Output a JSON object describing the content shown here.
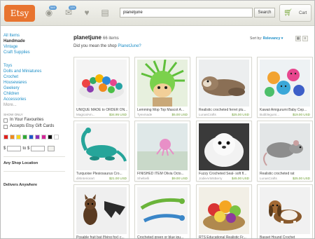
{
  "header": {
    "logo": "Etsy",
    "badge_favorites": "549",
    "badge_messages": "129",
    "search_value": "planetjune",
    "search_button": "Search",
    "cart_label": "Cart"
  },
  "sidebar": {
    "categories": [
      "All Items",
      "Handmade",
      "Vintage",
      "Craft Supplies"
    ],
    "subcategories": [
      "Toys",
      "Dolls and Miniatures",
      "Crochet",
      "Housewares",
      "Geekery",
      "Children",
      "Accessories",
      "More..."
    ],
    "show_only_label": "SHOW ONLY",
    "favorites_label": "In Your Favourites",
    "giftcard_label": "Accepts Etsy Gift Cards",
    "colors": [
      "#e0201c",
      "#f08a1e",
      "#f5d61b",
      "#2fa935",
      "#1e58c8",
      "#8c2fb8",
      "#d6269a",
      "#111111",
      "#ffffff"
    ],
    "price_currency": "$",
    "price_to": "to $",
    "shop_location": "Any Shop Location",
    "delivers": "Delivers Anywhere"
  },
  "main": {
    "shop_name": "planetjune",
    "item_count": "66 items",
    "suggest_prefix": "Did you mean the shop",
    "suggest_link": "PlanetJune?",
    "sort_label": "Sort by:",
    "sort_value": "Relevancy",
    "sort_caret": "▾",
    "items": [
      {
        "title": "UNIQUE MADE to ORDER ON...",
        "shop": "MagicalAm...",
        "price": "$34.95 USD",
        "img": "collection"
      },
      {
        "title": "Lemming Mop Top Mascot A...",
        "shop": "Tyexmade",
        "price": "$5.00 USD",
        "img": "mop"
      },
      {
        "title": "Realistic crocheted ferret plu...",
        "shop": "LunasCrafts",
        "price": "$25.00 USD",
        "img": "ferret"
      },
      {
        "title": "Kawaii Amigurumi Baby Cep...",
        "shop": "Bubblegumi...",
        "price": "$19.00 USD",
        "img": "octopus"
      },
      {
        "title": "Turquoise Plesiosaurus Cro...",
        "shop": "dirtinteriorart",
        "price": "$21.00 USD",
        "img": "plesio"
      },
      {
        "title": "FINISHED ITEM Olivia Octo...",
        "shop": "Sheltielli",
        "price": "$9.00 USD",
        "img": "smallocto"
      },
      {
        "title": "Fuzzy Crocheted Seal- soft fl...",
        "shop": "JodieArtsNBerry",
        "price": "$45.00 USD",
        "img": "seal"
      },
      {
        "title": "Realistic crocheted rat",
        "shop": "LunasCrafts",
        "price": "$25.00 USD",
        "img": "rat"
      },
      {
        "title": "Posable fruit bat (flying fox) c...",
        "shop": "LunasCrafts",
        "price": "$20.00 USD",
        "img": "bats"
      },
      {
        "title": "Crocheted green or blue igu...",
        "shop": "LunasArtsStudio",
        "price": "$20.00 USD",
        "img": "iguana"
      },
      {
        "title": "RTS Educational Realistic Fr...",
        "shop": "HappyHeartCrafts",
        "price": "$25.00 USD",
        "img": "fruit"
      },
      {
        "title": "Basset Hound Crochet",
        "shop": "dirtinteriorart",
        "price": "$30.00 USD",
        "img": "basset"
      }
    ]
  }
}
